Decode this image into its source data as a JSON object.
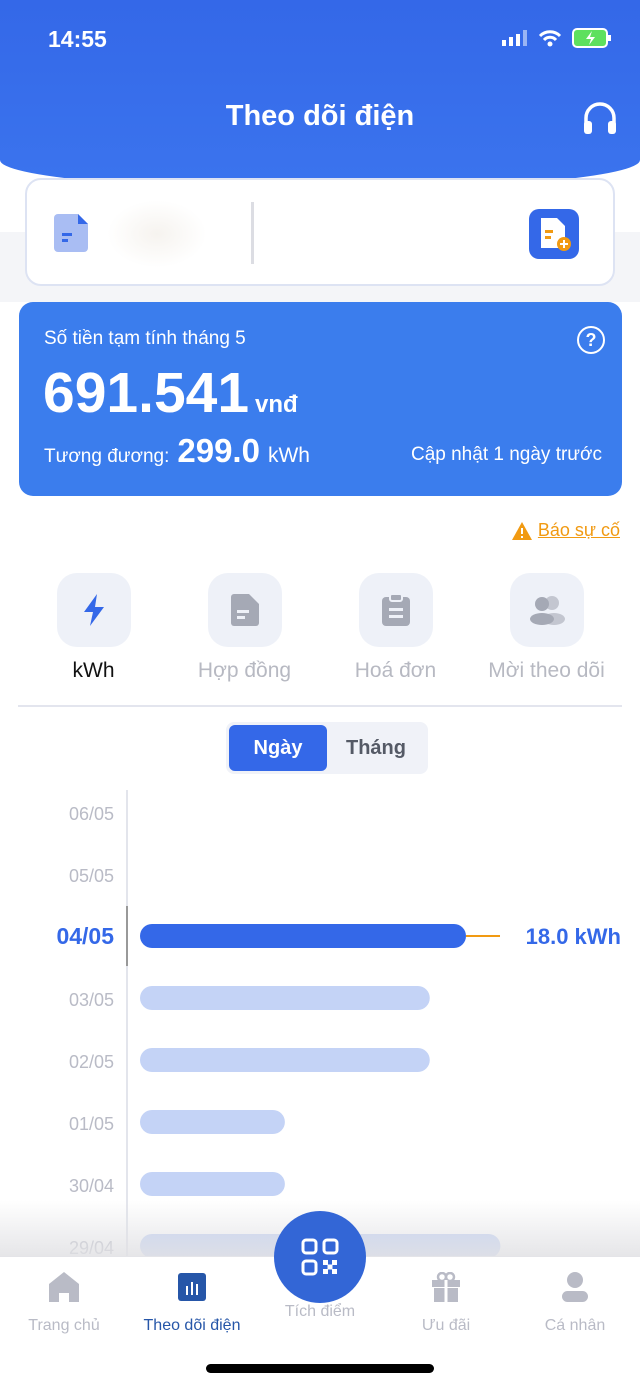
{
  "status": {
    "time": "14:55"
  },
  "header": {
    "title": "Theo dõi điện"
  },
  "card": {
    "label": "Số tiền tạm tính tháng 5",
    "amount": "691.541",
    "unit": "vnđ",
    "equiv_label": "Tương đương:",
    "equiv_value": "299.0",
    "equiv_unit": "kWh",
    "updated": "Cập nhật 1 ngày trước"
  },
  "report": "Báo sự cố",
  "tabs": [
    {
      "label": "kWh"
    },
    {
      "label": "Hợp đồng"
    },
    {
      "label": "Hoá đơn"
    },
    {
      "label": "Mời theo dõi"
    }
  ],
  "segment": {
    "day": "Ngày",
    "month": "Tháng"
  },
  "chart_data": {
    "type": "bar",
    "orientation": "horizontal",
    "categories": [
      "06/05",
      "05/05",
      "04/05",
      "03/05",
      "02/05",
      "01/05",
      "30/04",
      "29/04"
    ],
    "values": [
      0,
      0,
      18.0,
      16.0,
      16.0,
      8.0,
      8.0,
      19.9
    ],
    "unit": "kWh",
    "selected": "04/05",
    "selected_label": "18.0 kWh"
  },
  "nav": [
    {
      "label": "Trang chủ"
    },
    {
      "label": "Theo dõi điện"
    },
    {
      "label": "Tích điểm"
    },
    {
      "label": "Ưu đãi"
    },
    {
      "label": "Cá nhân"
    }
  ],
  "colors": {
    "primary": "#3468e8",
    "bar": "#c4d3f6",
    "warning": "#f19a12",
    "nav_active": "#2656a8"
  }
}
